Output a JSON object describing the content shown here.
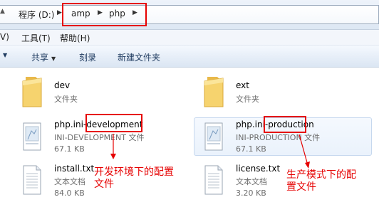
{
  "address_bar": {
    "partial_left": "▲",
    "drive": "程序 (D:)",
    "folder1": "amp",
    "folder2": "php"
  },
  "menu": {
    "view_partial": "V)",
    "tools": "工具(T)",
    "help": "帮助(H)"
  },
  "toolbar": {
    "share": "共享",
    "burn": "刻录",
    "new_folder": "新建文件夹"
  },
  "files": [
    {
      "name": "dev",
      "type": "文件夹",
      "size": "",
      "icon": "folder-icon"
    },
    {
      "name": "ext",
      "type": "文件夹",
      "size": "",
      "icon": "folder-icon"
    },
    {
      "name": "php.ini-development",
      "type": "INI-DEVELOPMENT 文件",
      "size": "67.1 KB",
      "icon": "ini-file-icon"
    },
    {
      "name": "php.ini-production",
      "type": "INI-PRODUCTION 文件",
      "size": "67.1 KB",
      "icon": "ini-file-icon"
    },
    {
      "name": "install.txt",
      "type": "文本文档",
      "size": "84.0 KB",
      "icon": "text-file-icon"
    },
    {
      "name": "license.txt",
      "type": "文本文档",
      "size": "3.20 KB",
      "icon": "text-file-icon"
    }
  ],
  "annotations": {
    "dev_line1": "开发环境下的配置",
    "dev_line2": "文件",
    "prod_line1": "生产模式下的配",
    "prod_line2": "置文件"
  },
  "colors": {
    "annotation_red": "#e60000",
    "folder_yellow": "#f2c94c"
  }
}
